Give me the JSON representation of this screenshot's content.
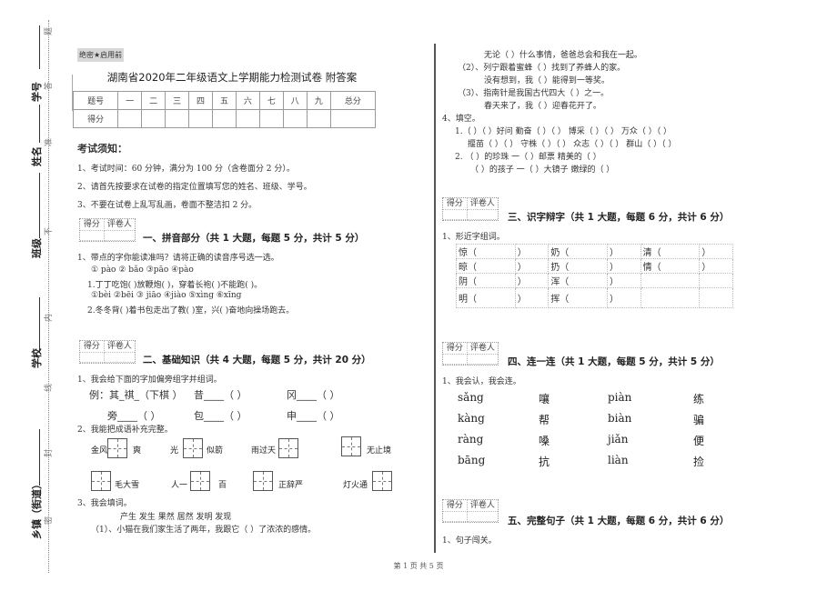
{
  "gutter": {
    "fields": [
      "学号",
      "姓名",
      "班级",
      "学校",
      "乡镇（街道）"
    ],
    "seal_chars": [
      "题",
      "答",
      "准",
      "不",
      "内",
      "线",
      "封",
      "密"
    ]
  },
  "header": {
    "secret_tag": "绝密★启用前",
    "title": "湖南省2020年二年级语文上学期能力检测试卷 附答案"
  },
  "score_table": {
    "header": [
      "题号",
      "一",
      "二",
      "三",
      "四",
      "五",
      "六",
      "七",
      "八",
      "九",
      "总分"
    ],
    "row_label": "得分"
  },
  "notice": {
    "heading": "考试须知：",
    "items": [
      "1、考试时间：60 分钟，满分为 100 分（含卷面分 2 分）。",
      "2、请首先按要求在试卷的指定位置填写您的姓名、班级、学号。",
      "3、不要在试卷上乱写乱画，卷面不整洁扣 2 分。"
    ]
  },
  "scorebox": {
    "score": "得分",
    "grader": "评卷人"
  },
  "section1": {
    "title": "一、拼音部分（共 1 大题，每题 5 分，共计 5 分）",
    "q1": "1、带点的字你能读准吗？请将正确的读音序号选一选。",
    "opts1": "① pào      ② bǎo        ③pāo       ④pào",
    "s1": "1.丁丁吃饱(    )放鞭炮(    )，穿着长袍(    )不能跑(    )。",
    "opts2": "①bèi ②bēi        ③ jiāo ④jiào     ⑤xìng     ⑥xīng",
    "s2": "2.冬冬背(    )着书包走出了教(    )室，兴(    )奋地向操场跑去。"
  },
  "section2": {
    "title": "二、基础知识（共 4 大题，每题 5 分，共计 20 分）",
    "q1": "1、我会给下面的字加偏旁组字并组词。",
    "row1": [
      "例：其_祺_（下棋  ）",
      "昔____（      ）",
      "冈____（      ）"
    ],
    "row2": [
      "旁____（      ）",
      "包____（      ）",
      "申____（      ）"
    ],
    "q2": "2、我能把成语补充完整。",
    "idioms": [
      {
        "pre": "金风",
        "post": "爽"
      },
      {
        "pre": "光",
        "post": "似箭"
      },
      {
        "pre": "雨过天",
        "post": ""
      },
      {
        "pre": "",
        "post": "无止境"
      },
      {
        "pre": "",
        "post": "毛大雪"
      },
      {
        "pre": "人一",
        "post": "百"
      },
      {
        "pre": "",
        "post": "正辞严"
      },
      {
        "pre": "灯火通",
        "post": ""
      }
    ],
    "q3": "3、我会填词。",
    "words": "产生    发生       果然       居然      发明    发现",
    "q3_1": "（1）、小猫在我们家生活了两年，我跟它（      ）了浓浓的感情。"
  },
  "right_col": {
    "lines": [
      "无论（      ）什么事情，爸爸总会和我在一起。",
      "（2）、列宁跟着蜜蜂（      ）找到了养蜂人的家。",
      "没有想到，我（      ）能得到一等奖。",
      "（3）、指南针是我国古代四大（      ）之一。",
      "春天来了，我（      ）迎春花开了。"
    ],
    "q4": "4、填空。",
    "fill1a": "1.（  ）（  ）好问    勤奋（  ）（  ）      博采（  ）（  ）     万众（  ）（  ）",
    "fill1b": "揠苗（  ）（  ）    守株（  ）（  ）      众志（  ）（  ）     群山（  ）（  ）",
    "fill2a": "2. （     ）的珍珠        一（     ）邮票       精美的（      ）",
    "fill2b": "（     ）的孩子        一（     ）大镜子    嫩绿的（      ）"
  },
  "section3": {
    "title": "三、识字辩字（共 1 大题，每题 6 分，共计 6 分）",
    "q1": "1、形近字组词。",
    "rows": [
      [
        "惊（",
        "）",
        "奶（",
        "）",
        "清（",
        "）"
      ],
      [
        "晾（",
        "）",
        "扔（",
        "）",
        "情（",
        "）"
      ],
      [
        "阴（",
        "）",
        "浑（",
        "）",
        "",
        ""
      ],
      [
        "明（",
        "）",
        "挥（",
        "）",
        "",
        ""
      ]
    ]
  },
  "section4": {
    "title": "四、连一连（共 1 大题，每题 5 分，共计 5 分）",
    "q1": "1、我会认，我会连。",
    "col1": [
      "sǎng",
      "kàng",
      "ràng",
      "bāng"
    ],
    "col2": [
      "嚷",
      "帮",
      "嗓",
      "抗"
    ],
    "col3": [
      "piàn",
      "biàn",
      "jiǎn",
      "liàn"
    ],
    "col4": [
      "练",
      "骗",
      "便",
      "捡"
    ]
  },
  "section5": {
    "title": "五、完整句子（共 1 大题，每题 6 分，共计 6 分）",
    "q1": "1、句子闯关。"
  },
  "footer": {
    "page": "第 1 页 共 5 页"
  }
}
